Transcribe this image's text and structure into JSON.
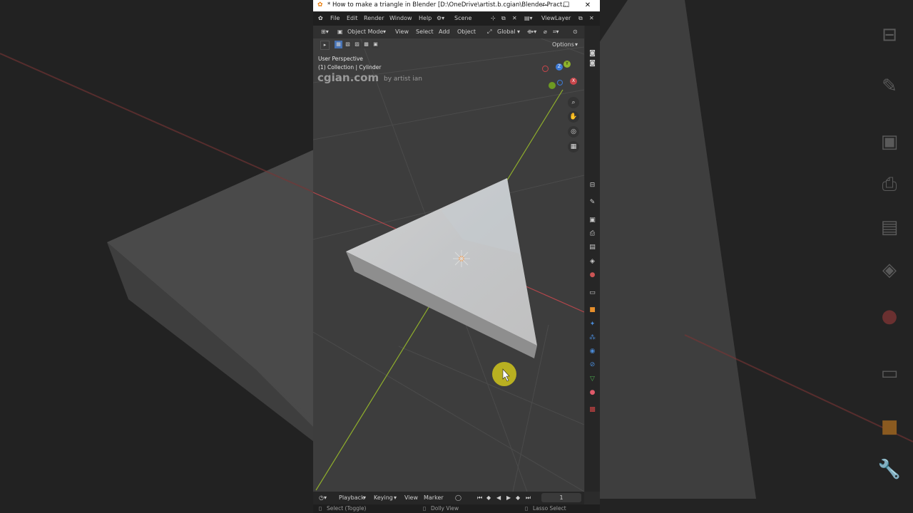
{
  "window": {
    "title": "* How to make a triangle in Blender [D:\\OneDrive\\artist.b.cgian\\Blender-Pract..."
  },
  "topbar": {
    "menus": [
      "File",
      "Edit",
      "Render",
      "Window",
      "Help"
    ],
    "scene": "Scene",
    "view_layer": "ViewLayer"
  },
  "header": {
    "mode": "Object Mode",
    "menus": [
      "View",
      "Select",
      "Add",
      "Object"
    ],
    "orientation": "Global",
    "options": "Options"
  },
  "viewport": {
    "perspective": "User Perspective",
    "collection": "(1) Collection | Cylinder",
    "watermark": "cgian.com",
    "watermark_by": "by artist ian",
    "gizmo": {
      "z": "Z",
      "y": "Y",
      "x": "X"
    }
  },
  "timeline": {
    "playback": "Playback",
    "keying": "Keying",
    "view": "View",
    "marker": "Marker",
    "frame": "1"
  },
  "statusbar": {
    "select": "Select (Toggle)",
    "dolly": "Dolly View",
    "lasso": "Lasso Select"
  },
  "colors": {
    "x_axis": "#c8464b",
    "y_axis": "#8fb32c",
    "cursor": "#cfc21f",
    "triangle": "#c8c8c8"
  }
}
